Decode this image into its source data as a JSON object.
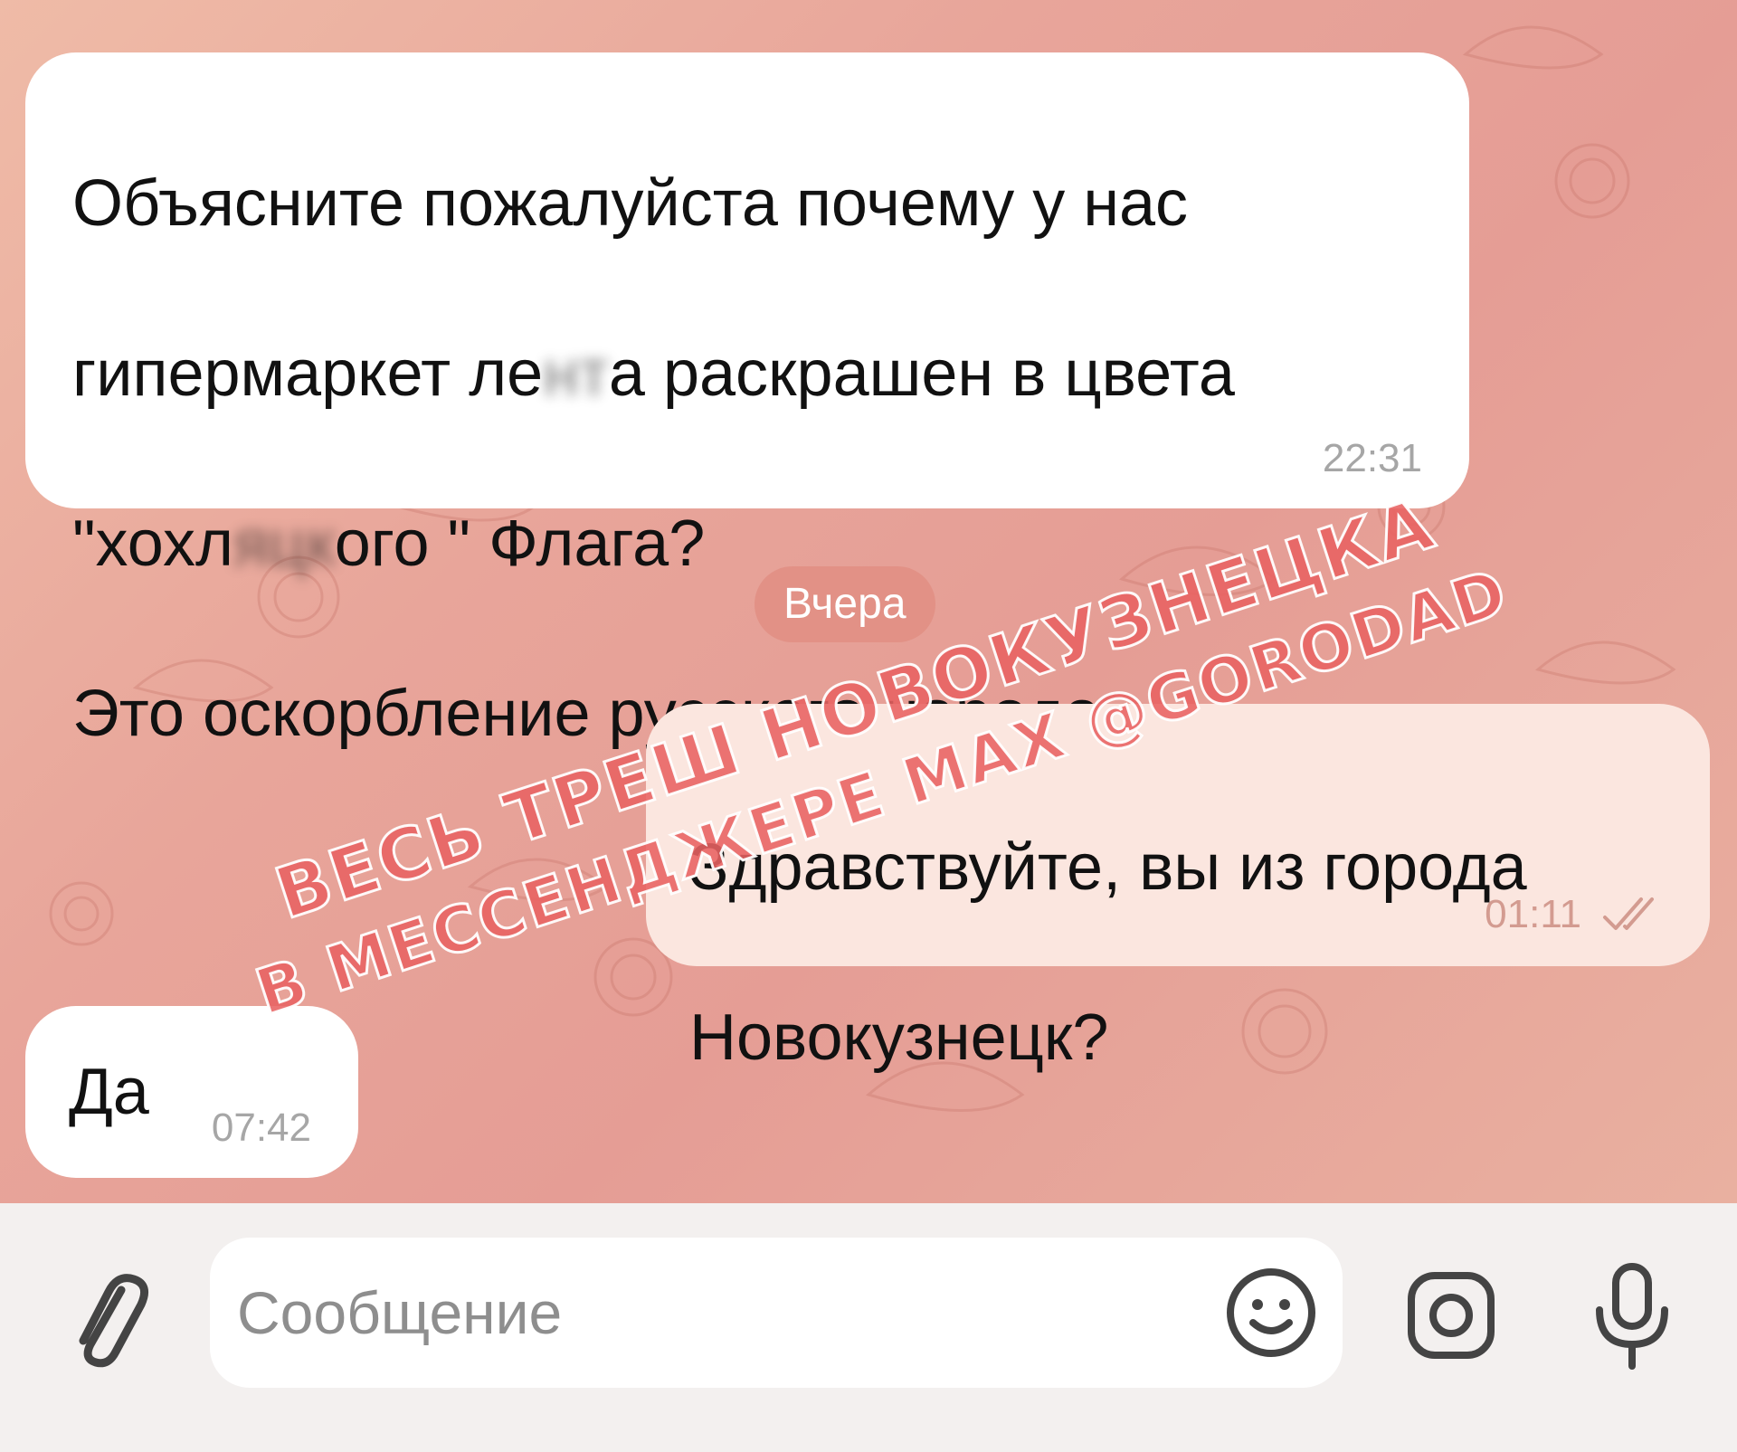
{
  "messages": [
    {
      "direction": "incoming",
      "line1": "Объясните пожалуйста почему у нас",
      "line2_prefix": "гипермаркет ле",
      "line2_blur": "нт",
      "line2_suffix": "а раскрашен в цвета",
      "line3_prefix": "\"хохл",
      "line3_blur": "яцк",
      "line3_suffix": "ого \" Флага?",
      "line4": "Это оскорбление русского народа",
      "time": "22:31"
    },
    {
      "direction": "outgoing",
      "line1": "Здравствуйте, вы из города",
      "line2": "Новокузнецк?",
      "time": "01:11",
      "status": "double-check-read"
    },
    {
      "direction": "incoming",
      "line1": "Да",
      "time": "07:42"
    }
  ],
  "date_divider": "Вчера",
  "watermark": {
    "line1": "весь треш новокузнецка",
    "line2": "в мессенджере MAX @GORODAD"
  },
  "composer": {
    "placeholder": "Сообщение",
    "attach_icon": "paperclip-icon",
    "emoji_icon": "emoji-icon",
    "camera_icon": "camera-icon",
    "mic_icon": "microphone-icon"
  },
  "colors": {
    "incoming_bubble": "#ffffff",
    "outgoing_bubble": "#fbe6df",
    "date_pill": "#e08e82",
    "watermark": "#e86262",
    "composer_bg": "#f3f0ef"
  }
}
